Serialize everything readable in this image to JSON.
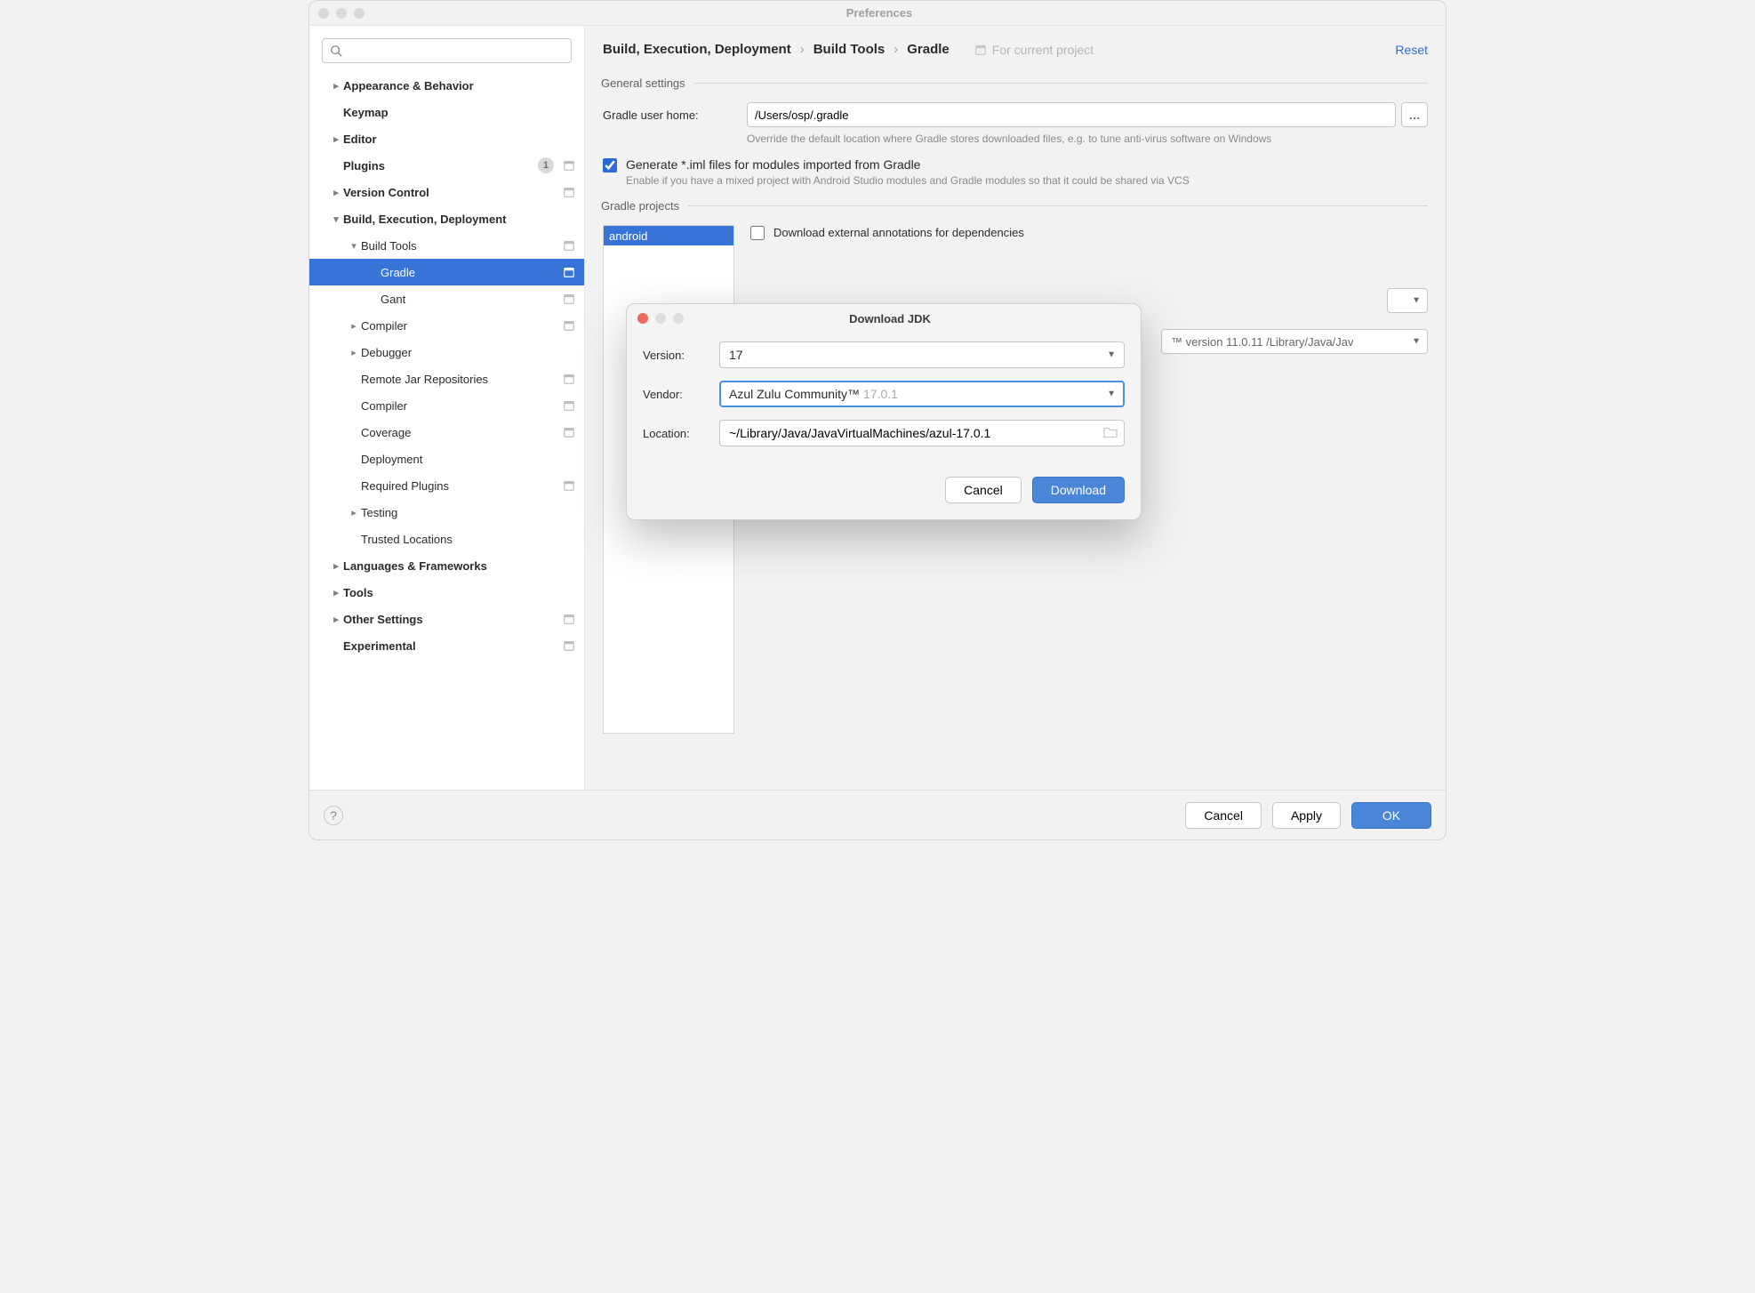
{
  "window": {
    "title": "Preferences"
  },
  "search": {
    "placeholder": ""
  },
  "sidebar": {
    "items": [
      {
        "label": "Appearance & Behavior",
        "indent": 0,
        "chev": "closed",
        "bold": true
      },
      {
        "label": "Keymap",
        "indent": 0,
        "chev": "none",
        "bold": true
      },
      {
        "label": "Editor",
        "indent": 0,
        "chev": "closed",
        "bold": true
      },
      {
        "label": "Plugins",
        "indent": 0,
        "chev": "none",
        "bold": true,
        "badge": "1",
        "proj": true
      },
      {
        "label": "Version Control",
        "indent": 0,
        "chev": "closed",
        "bold": true,
        "proj": true
      },
      {
        "label": "Build, Execution, Deployment",
        "indent": 0,
        "chev": "open",
        "bold": true
      },
      {
        "label": "Build Tools",
        "indent": 1,
        "chev": "open",
        "proj": true
      },
      {
        "label": "Gradle",
        "indent": 2,
        "chev": "none",
        "proj": true,
        "selected": true
      },
      {
        "label": "Gant",
        "indent": 2,
        "chev": "none",
        "proj": true
      },
      {
        "label": "Compiler",
        "indent": 1,
        "chev": "closed",
        "proj": true
      },
      {
        "label": "Debugger",
        "indent": 1,
        "chev": "closed"
      },
      {
        "label": "Remote Jar Repositories",
        "indent": 1,
        "chev": "none",
        "proj": true
      },
      {
        "label": "Compiler",
        "indent": 1,
        "chev": "none",
        "proj": true
      },
      {
        "label": "Coverage",
        "indent": 1,
        "chev": "none",
        "proj": true
      },
      {
        "label": "Deployment",
        "indent": 1,
        "chev": "none"
      },
      {
        "label": "Required Plugins",
        "indent": 1,
        "chev": "none",
        "proj": true
      },
      {
        "label": "Testing",
        "indent": 1,
        "chev": "closed"
      },
      {
        "label": "Trusted Locations",
        "indent": 1,
        "chev": "none"
      },
      {
        "label": "Languages & Frameworks",
        "indent": 0,
        "chev": "closed",
        "bold": true
      },
      {
        "label": "Tools",
        "indent": 0,
        "chev": "closed",
        "bold": true
      },
      {
        "label": "Other Settings",
        "indent": 0,
        "chev": "closed",
        "bold": true,
        "proj": true
      },
      {
        "label": "Experimental",
        "indent": 0,
        "chev": "none",
        "bold": true,
        "proj": true
      }
    ]
  },
  "breadcrumb": {
    "parts": [
      "Build, Execution, Deployment",
      "Build Tools",
      "Gradle"
    ],
    "for_project": "For current project",
    "reset": "Reset"
  },
  "general": {
    "legend": "General settings",
    "user_home_label": "Gradle user home:",
    "user_home_value": "/Users/osp/.gradle",
    "user_home_hint": "Override the default location where Gradle stores downloaded files, e.g. to tune anti-virus software on Windows",
    "generate_iml_label": "Generate *.iml files for modules imported from Gradle",
    "generate_iml_hint": "Enable if you have a mixed project with Android Studio modules and Gradle modules so that it could be shared via VCS",
    "generate_iml_checked": true
  },
  "gradle_projects": {
    "legend": "Gradle projects",
    "entries": [
      "android"
    ],
    "download_annotations_label": "Download external annotations for dependencies",
    "download_annotations_checked": false,
    "jvm_peek": "™ version 11.0.11 /Library/Java/Jav"
  },
  "modal": {
    "title": "Download JDK",
    "version_label": "Version:",
    "version_value": "17",
    "vendor_label": "Vendor:",
    "vendor_value": "Azul Zulu Community™",
    "vendor_suffix": "17.0.1",
    "location_label": "Location:",
    "location_value": "~/Library/Java/JavaVirtualMachines/azul-17.0.1",
    "cancel": "Cancel",
    "download": "Download"
  },
  "footer": {
    "cancel": "Cancel",
    "apply": "Apply",
    "ok": "OK"
  },
  "icons": {
    "ellipsis": "…"
  }
}
